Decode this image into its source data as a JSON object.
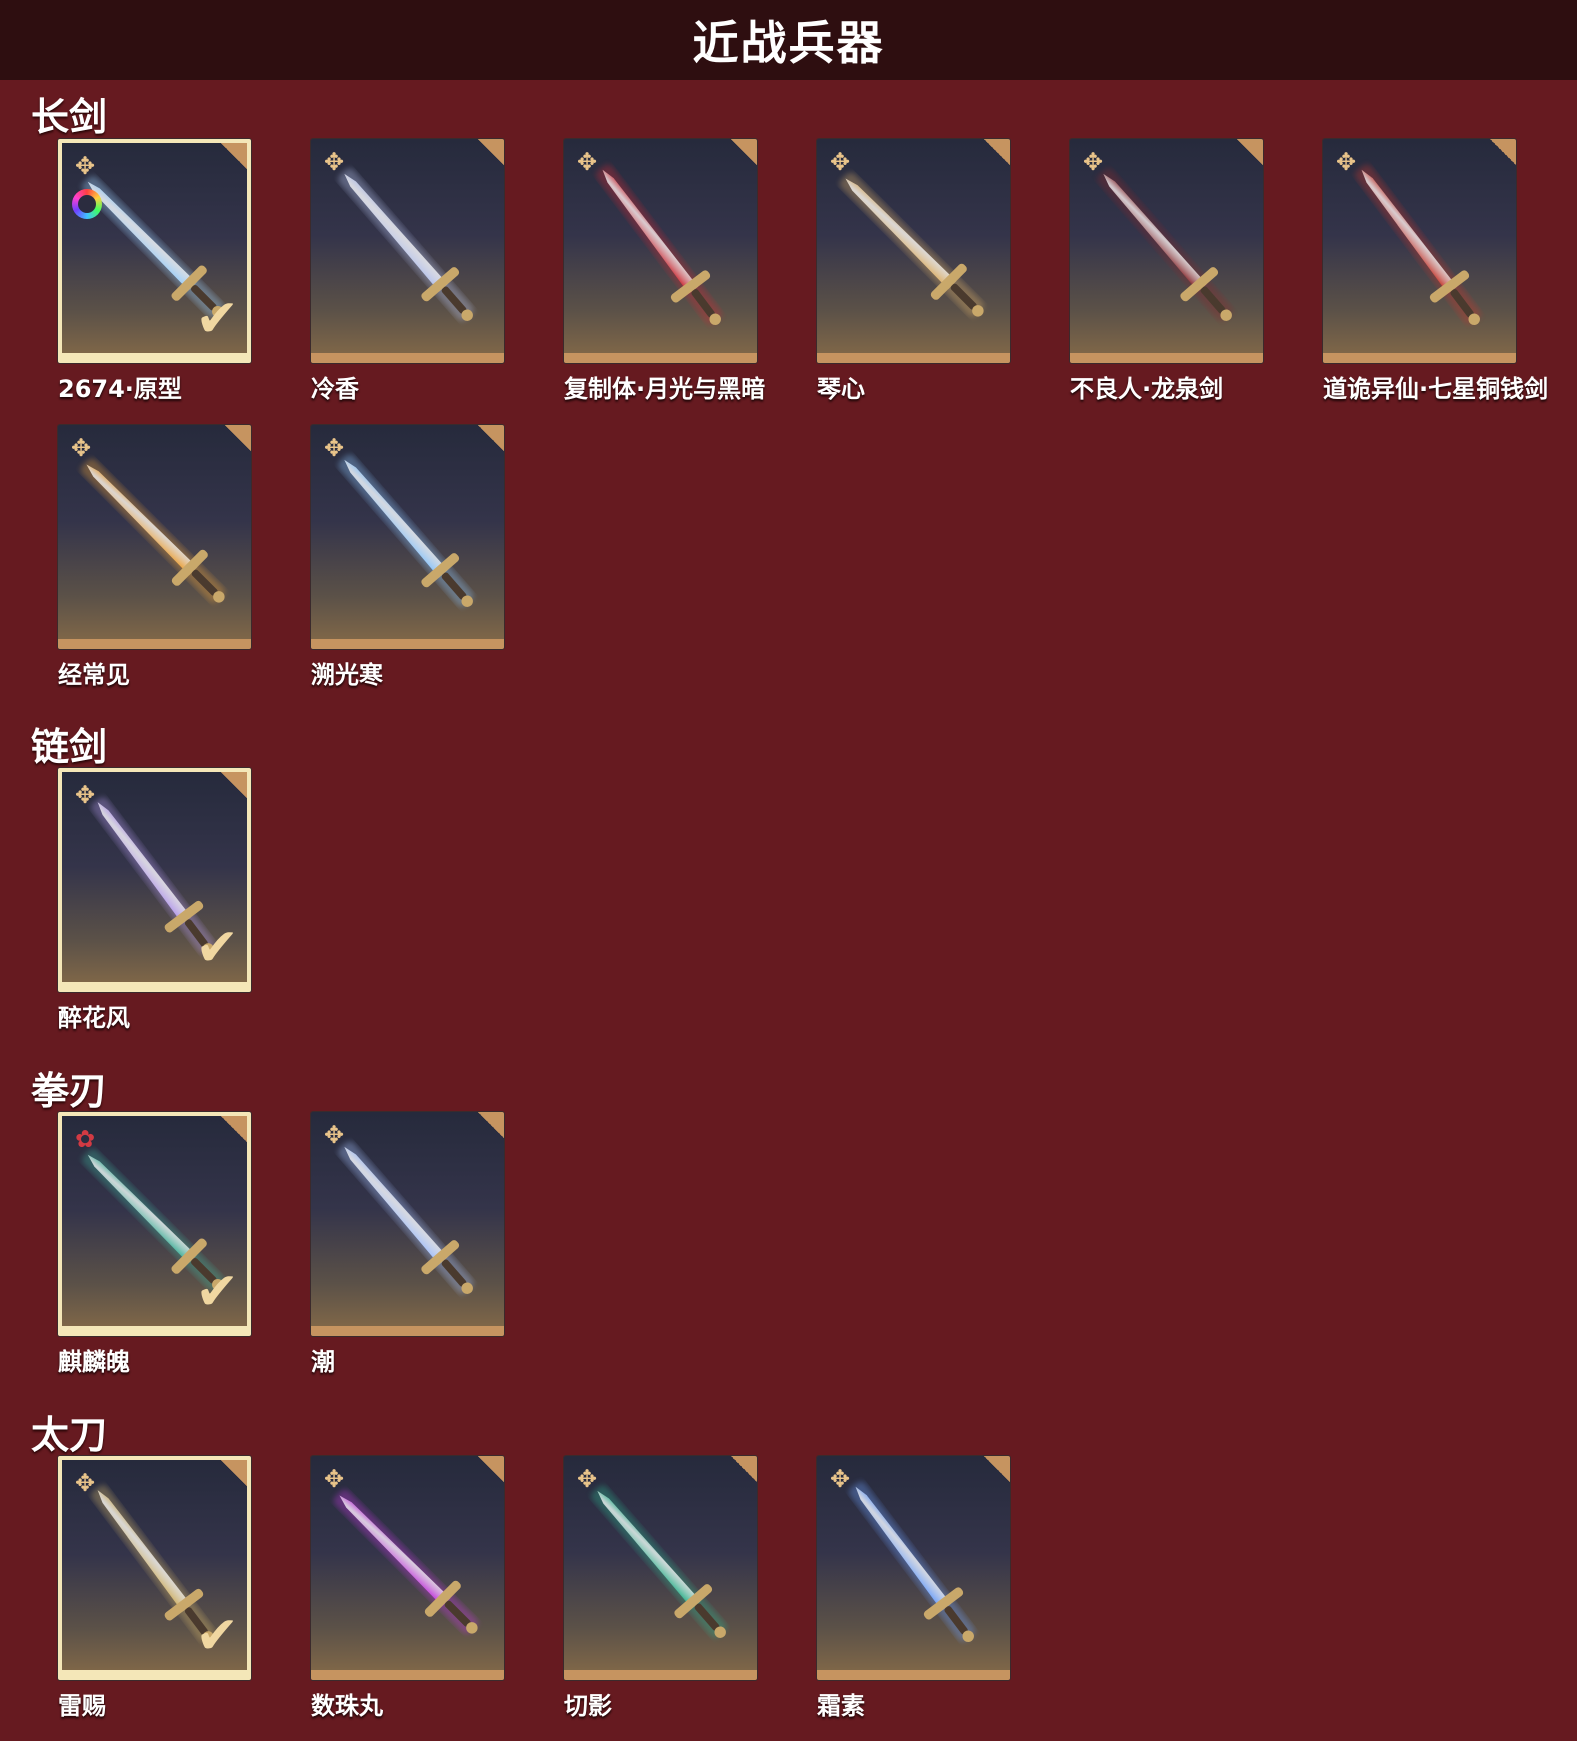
{
  "header": {
    "title": "近战兵器"
  },
  "sections": [
    {
      "title": "长剑",
      "items": [
        {
          "name": "2674·原型",
          "selected": true,
          "rarity_icon": "gold-flower-icon",
          "has_color_wheel": true,
          "art_color": "#9fd3ff"
        },
        {
          "name": "冷香",
          "selected": false,
          "rarity_icon": "gold-flower-icon",
          "art_color": "#b9c6f0"
        },
        {
          "name": "复制体·月光与黑暗",
          "selected": false,
          "rarity_icon": "gold-flower-icon",
          "art_color": "#d02a34"
        },
        {
          "name": "琴心",
          "selected": false,
          "rarity_icon": "gold-flower-icon",
          "art_color": "#e0b36a"
        },
        {
          "name": "不良人·龙泉剑",
          "selected": false,
          "rarity_icon": "gold-flower-icon",
          "art_color": "#8a2a2e"
        },
        {
          "name": "道诡异仙·七星铜钱剑",
          "selected": false,
          "rarity_icon": "gold-flower-icon",
          "art_color": "#c8372d"
        },
        {
          "name": "经常见",
          "selected": false,
          "rarity_icon": "gold-flower-icon",
          "art_color": "#f0a43a"
        },
        {
          "name": "溯光寒",
          "selected": false,
          "rarity_icon": "gold-flower-icon",
          "art_color": "#8fc8ff"
        }
      ]
    },
    {
      "title": "链剑",
      "items": [
        {
          "name": "醉花风",
          "selected": true,
          "rarity_icon": "gold-flower-icon",
          "art_color": "#b79cf0"
        }
      ]
    },
    {
      "title": "拳刃",
      "items": [
        {
          "name": "麒麟魄",
          "selected": true,
          "rarity_icon": "red-flower-icon",
          "art_color": "#3fb39b"
        },
        {
          "name": "潮",
          "selected": false,
          "rarity_icon": "gold-flower-icon",
          "art_color": "#a8c4ff"
        }
      ]
    },
    {
      "title": "太刀",
      "items": [
        {
          "name": "雷赐",
          "selected": true,
          "rarity_icon": "gold-flower-icon",
          "art_color": "#d3b56a"
        },
        {
          "name": "数珠丸",
          "selected": false,
          "rarity_icon": "gold-flower-icon",
          "art_color": "#c53ae0"
        },
        {
          "name": "切影",
          "selected": false,
          "rarity_icon": "gold-flower-icon",
          "art_color": "#2fb58f"
        },
        {
          "name": "霜素",
          "selected": false,
          "rarity_icon": "gold-flower-icon",
          "art_color": "#6fa3ff"
        }
      ]
    }
  ]
}
